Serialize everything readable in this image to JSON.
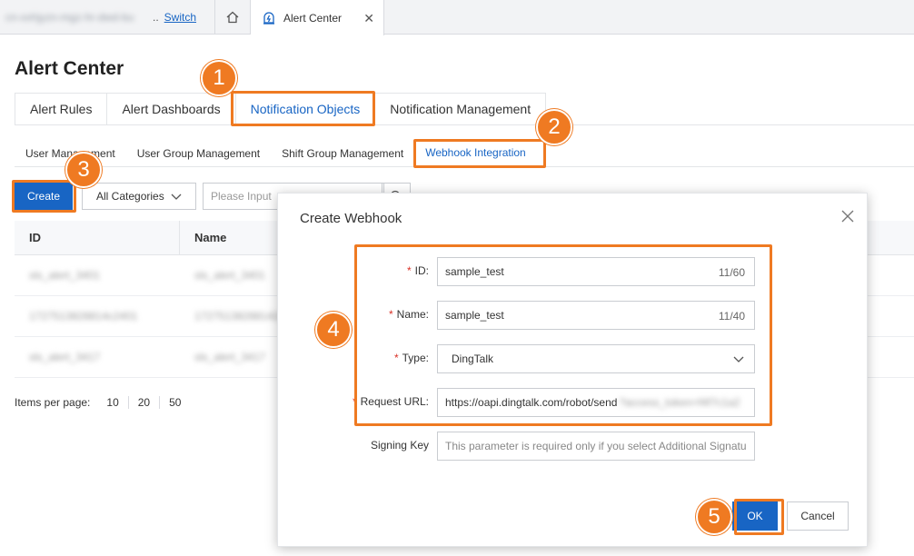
{
  "topbar": {
    "instance_name": "cn-xxhjyzn-mgz-hr-dwd-bu",
    "switch_label": "Switch",
    "active_tab_label": "Alert Center",
    "close_glyph": "✕"
  },
  "page": {
    "title": "Alert Center"
  },
  "main_tabs": [
    {
      "label": "Alert Rules"
    },
    {
      "label": "Alert Dashboards"
    },
    {
      "label": "Notification Objects"
    },
    {
      "label": "Notification Management"
    }
  ],
  "sub_tabs": [
    {
      "label": "User Management"
    },
    {
      "label": "User Group Management"
    },
    {
      "label": "Shift Group Management"
    },
    {
      "label": "Webhook Integration"
    }
  ],
  "toolbar": {
    "create_label": "Create",
    "category_value": "All Categories",
    "search_placeholder": "Please Input"
  },
  "table": {
    "columns": [
      "ID",
      "Name"
    ],
    "rows": [
      [
        "sls_alert_3401",
        "sls_alert_3401"
      ],
      [
        "1727513828814c2401",
        "17275138288142c401"
      ],
      [
        "sls_alert_3417",
        "sls_alert_3417"
      ]
    ]
  },
  "pagination": {
    "label": "Items per page:",
    "options": [
      "10",
      "20",
      "50"
    ]
  },
  "dialog": {
    "title": "Create Webhook",
    "required_mark": "*",
    "fields": {
      "id": {
        "label": "ID:",
        "value": "sample_test",
        "count": "11/60"
      },
      "name": {
        "label": "Name:",
        "value": "sample_test",
        "count": "11/40"
      },
      "type": {
        "label": "Type:",
        "value": "DingTalk"
      },
      "url": {
        "label": "Request URL:",
        "value": "https://oapi.dingtalk.com/robot/send",
        "hidden_part": "?access_token=f4f7c1a2"
      },
      "signing": {
        "label": "Signing Key",
        "placeholder": "This parameter is required only if you select Additional Signatu"
      }
    },
    "ok_label": "OK",
    "cancel_label": "Cancel"
  },
  "steps": [
    "1",
    "2",
    "3",
    "4",
    "5"
  ],
  "colors": {
    "accent": "#1865c4",
    "annotation": "#ef7a22",
    "required": "#d93026"
  }
}
